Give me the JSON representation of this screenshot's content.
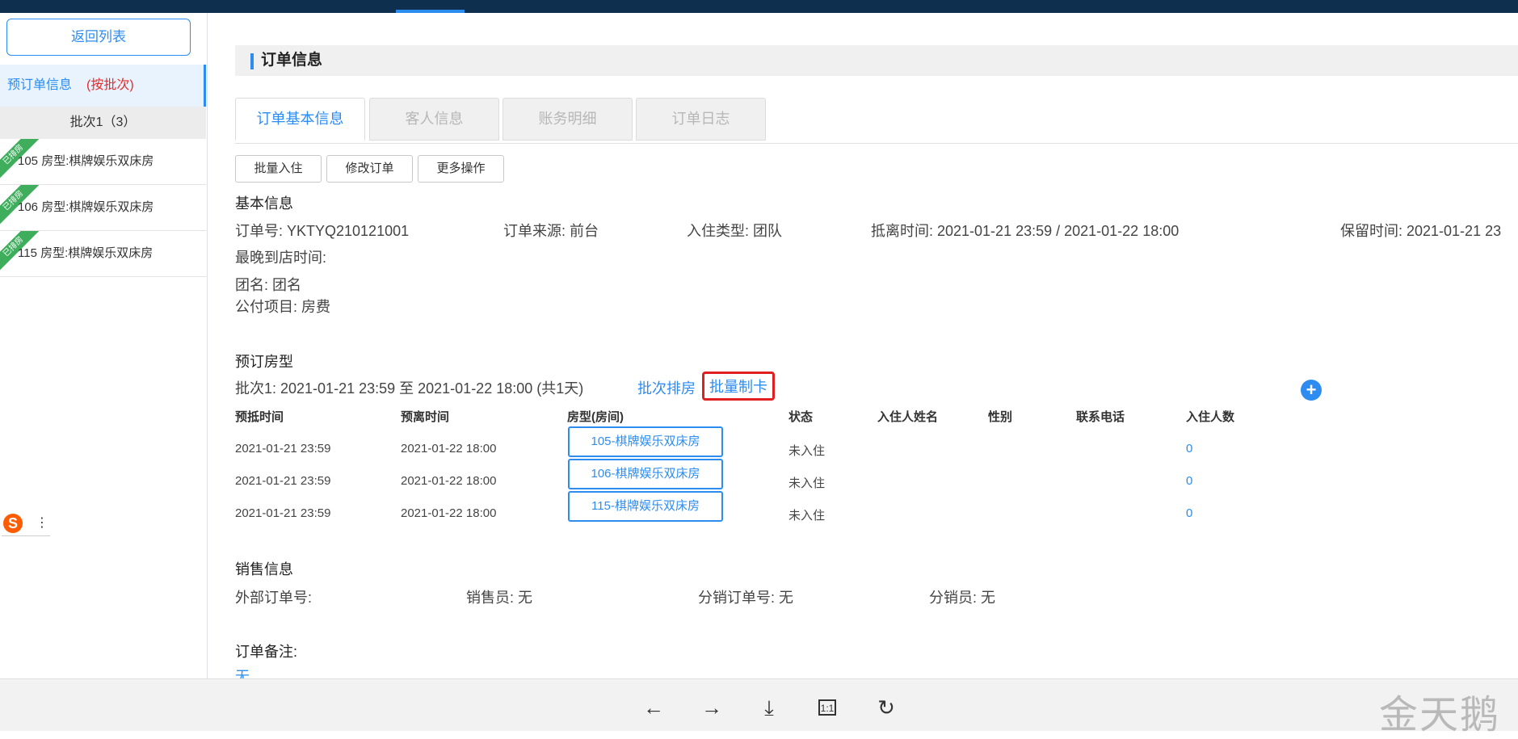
{
  "topbar": {
    "right_text_1": "",
    "right_text_2": ""
  },
  "sidebar": {
    "back_label": "返回列表",
    "section_label": "预订单信息",
    "section_tag": "(按批次)",
    "batch_label": "批次1（3）",
    "ribbon_text": "已排房",
    "rooms": [
      {
        "text": "105  房型:棋牌娱乐双床房"
      },
      {
        "text": "106  房型:棋牌娱乐双床房"
      },
      {
        "text": "115  房型:棋牌娱乐双床房"
      }
    ],
    "ime_logo": "S",
    "ime_more": "⋮"
  },
  "main": {
    "section_title": "订单信息",
    "tabs": [
      {
        "label": "订单基本信息"
      },
      {
        "label": "客人信息"
      },
      {
        "label": "账务明细"
      },
      {
        "label": "订单日志"
      }
    ],
    "ops": {
      "batch_checkin": "批量入住",
      "modify": "修改订单",
      "more": "更多操作"
    },
    "basic": {
      "heading": "基本信息",
      "order_no": "订单号: YKTYQ210121001",
      "source": "订单来源: 前台",
      "checkin_type": "入住类型: 团队",
      "arrive_leave": "抵离时间: 2021-01-21 23:59 / 2021-01-22 18:00",
      "keep_time": "保留时间: 2021-01-21 23",
      "latest_arrival": "最晚到店时间:",
      "group_name": "团名: 团名",
      "public_pay": "公付项目:  房费"
    },
    "booking": {
      "heading": "预订房型",
      "batch_line": "批次1: 2021-01-21 23:59 至 2021-01-22 18:00 (共1天)",
      "assign_link": "批次排房",
      "make_card_link": "批量制卡",
      "plus": "+",
      "columns": [
        "预抵时间",
        "预离时间",
        "房型(房间)",
        "状态",
        "入住人姓名",
        "性别",
        "联系电话",
        "入住人数"
      ],
      "rows": [
        {
          "arrive": "2021-01-21 23:59",
          "leave": "2021-01-22 18:00",
          "room": "105-棋牌娱乐双床房",
          "status": "未入住",
          "count": "0"
        },
        {
          "arrive": "2021-01-21 23:59",
          "leave": "2021-01-22 18:00",
          "room": "106-棋牌娱乐双床房",
          "status": "未入住",
          "count": "0"
        },
        {
          "arrive": "2021-01-21 23:59",
          "leave": "2021-01-22 18:00",
          "room": "115-棋牌娱乐双床房",
          "status": "未入住",
          "count": "0"
        }
      ]
    },
    "sales": {
      "heading": "销售信息",
      "external_no": "外部订单号:",
      "salesman": "销售员: 无",
      "dist_no": "分销订单号: 无",
      "distributor": "分销员: 无"
    },
    "remark": {
      "heading": "订单备注:",
      "value": "无"
    }
  },
  "bottombar": {
    "prev": "←",
    "next": "→",
    "download": "⤓",
    "actual_size": "1:1",
    "rotate": "↻",
    "watermark": "金天鹅"
  },
  "colors": {
    "accent": "#2d8cf0",
    "topbar": "#0f2f4f",
    "highlight_box": "#e02020",
    "ribbon": "#3fae5c"
  }
}
